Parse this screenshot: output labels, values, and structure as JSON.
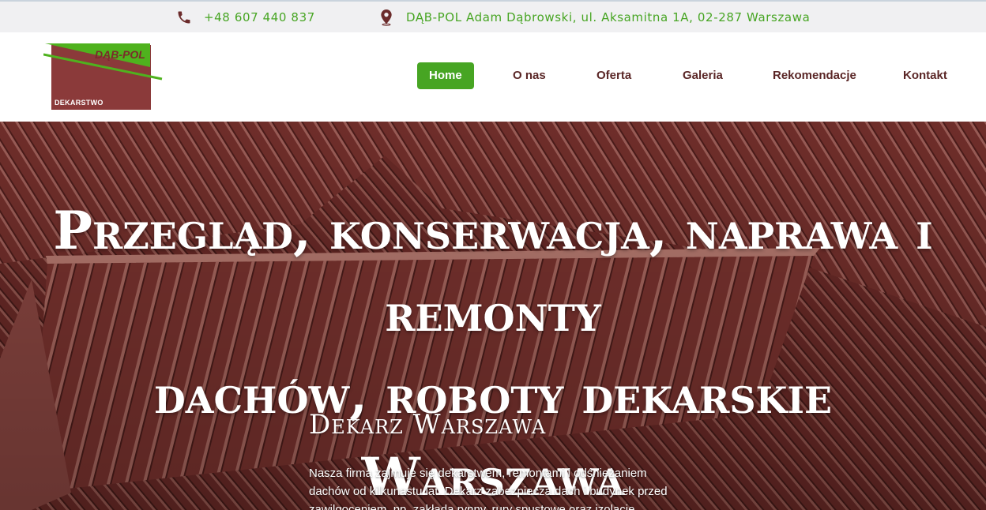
{
  "topbar": {
    "phone": "+48 607 440 837",
    "address": "DĄB-POL Adam Dąbrowski, ul. Aksamitna 1A, 02-287 Warszawa",
    "phone_icon": "phone-icon",
    "address_icon": "map-pin-icon"
  },
  "logo": {
    "brand": "DĄB-POL",
    "sub": "DEKARSTWO"
  },
  "nav": {
    "items": [
      {
        "label": "Home",
        "active": true
      },
      {
        "label": "O nas",
        "active": false
      },
      {
        "label": "Oferta",
        "active": false
      },
      {
        "label": "Galeria",
        "active": false
      },
      {
        "label": "Rekomendacje",
        "active": false
      },
      {
        "label": "Kontakt",
        "active": false
      }
    ]
  },
  "hero": {
    "title_line1": "Przegląd, konserwacja, naprawa i remonty",
    "title_line2": "dachów, roboty dekarskie Warszawa",
    "subtitle": "Dekarz Warszawa",
    "text": "Nasza firma zajmuje się dekarstwem, remontami i odśnieżaniem dachów od kilkunastu lat. Dekarz zabezpiecza dach i budynek przed zawilgoceniem, np. zakłada rynny, rury spustowe oraz izolacje"
  },
  "colors": {
    "accent": "#47a523",
    "brand_dark": "#5a2626",
    "roof": "#6d2e2b"
  }
}
